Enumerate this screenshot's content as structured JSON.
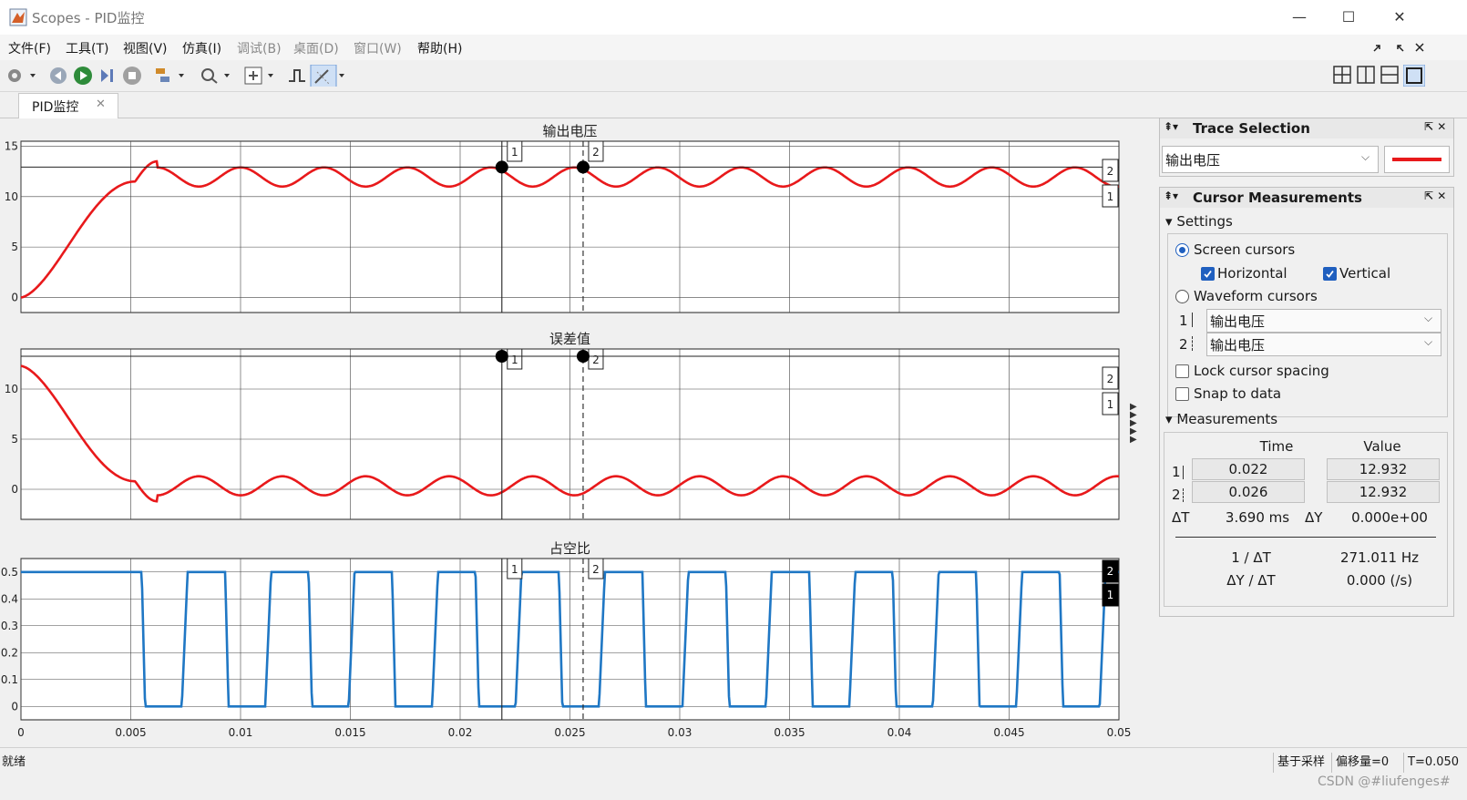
{
  "window": {
    "title": "Scopes - PID监控",
    "min_label": "—",
    "max_label": "☐",
    "close_label": "✕"
  },
  "menu": [
    {
      "label": "文件(F)",
      "enabled": true
    },
    {
      "label": "工具(T)",
      "enabled": true
    },
    {
      "label": "视图(V)",
      "enabled": true
    },
    {
      "label": "仿真(I)",
      "enabled": true
    },
    {
      "label": "调试(B)",
      "enabled": false
    },
    {
      "label": "桌面(D)",
      "enabled": false
    },
    {
      "label": "窗口(W)",
      "enabled": false
    },
    {
      "label": "帮助(H)",
      "enabled": true
    }
  ],
  "toolbar_icons": [
    "settings-icon",
    "step-back-icon",
    "run-icon",
    "step-forward-icon",
    "stop-icon",
    "highlight-icon",
    "zoom-icon",
    "fit-to-view-icon",
    "triggers-icon",
    "cursor-measurements-icon"
  ],
  "layout_icons": [
    "layout-2x2-icon",
    "layout-2col-icon",
    "layout-2row-icon",
    "layout-single-icon"
  ],
  "tab": {
    "label": "PID监控",
    "close": "✕"
  },
  "plots": [
    {
      "title": "输出电压"
    },
    {
      "title": "误差值"
    },
    {
      "title": "占空比"
    }
  ],
  "chart_data": [
    {
      "type": "line",
      "title": "输出电压",
      "xlim": [
        0,
        0.05
      ],
      "ylim": [
        -1.5,
        15.5
      ],
      "yticks": [
        "0",
        "5",
        "10",
        "15"
      ],
      "series": [
        {
          "color": "#e8191b",
          "desc": "rises from 0 to ~13.5 peak at 0.006, then oscillates between ~11 and ~12.9 with period ~0.0038"
        }
      ],
      "cursors": {
        "c1_x": 0.022,
        "c2_x": 0.026,
        "y": 12.932
      }
    },
    {
      "type": "line",
      "title": "误差值",
      "xlim": [
        0,
        0.05
      ],
      "ylim": [
        -3,
        14
      ],
      "yticks": [
        "0",
        "5",
        "10"
      ],
      "series": [
        {
          "color": "#e8191b"
        }
      ],
      "cursors": {
        "c1_x": 0.022,
        "c2_x": 0.026
      }
    },
    {
      "type": "line",
      "title": "占空比",
      "xlim": [
        0,
        0.05
      ],
      "ylim": [
        -0.05,
        0.55
      ],
      "yticks": [
        "0",
        "0.1",
        "0.2",
        "0.3",
        "0.4",
        "0.5"
      ],
      "xticks": [
        "0",
        "0.005",
        "0.01",
        "0.015",
        "0.02",
        "0.025",
        "0.03",
        "0.035",
        "0.04",
        "0.045",
        "0.05"
      ],
      "series": [
        {
          "color": "#1f77c4"
        }
      ]
    }
  ],
  "cursor_labels": [
    "1",
    "2"
  ],
  "trace_selection": {
    "title": "Trace Selection",
    "selected": "输出电压",
    "line_color": "#e8191b"
  },
  "cursor_measurements": {
    "title": "Cursor Measurements",
    "settings_label": "Settings",
    "screen_cursors": "Screen cursors",
    "horizontal": "Horizontal",
    "vertical": "Vertical",
    "waveform_cursors": "Waveform cursors",
    "c1_label": "1",
    "c2_label": "2",
    "c1_trace": "输出电压",
    "c2_trace": "输出电压",
    "lock_spacing": "Lock cursor spacing",
    "snap": "Snap to data",
    "measurements_label": "Measurements",
    "col_time": "Time",
    "col_value": "Value",
    "row1_time": "0.022",
    "row1_value": "12.932",
    "row2_time": "0.026",
    "row2_value": "12.932",
    "dt_label": "ΔT",
    "dt_value": "3.690 ms",
    "dy_label": "ΔY",
    "dy_value": "0.000e+00",
    "inv_dt_label": "1 / ΔT",
    "inv_dt_value": "271.011 Hz",
    "slope_label": "ΔY / ΔT",
    "slope_value": "0.000 (/s)"
  },
  "status": {
    "ready": "就绪",
    "sampling": "基于采样",
    "offset": "偏移量=0",
    "time": "T=0.050",
    "watermark": "CSDN @#liufenges#"
  }
}
